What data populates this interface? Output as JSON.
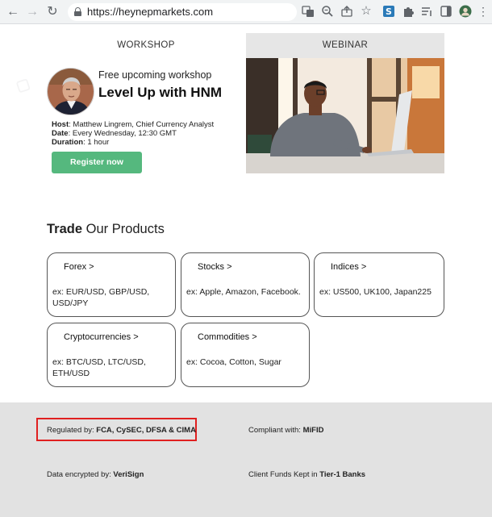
{
  "browser": {
    "url": "https://heynepmarkets.com",
    "back_icon": "back-arrow-icon",
    "forward_icon": "forward-arrow-icon",
    "reload_icon": "reload-icon"
  },
  "tabs": {
    "workshop": "WORKSHOP",
    "webinar": "WEBINAR"
  },
  "workshop": {
    "subtitle": "Free upcoming workshop",
    "title": "Level Up with HNM",
    "host_label": "Host",
    "host_value": ": Matthew Lingrem, Chief Currency Analyst",
    "date_label": "Date",
    "date_value": ": Every Wednesday, 12:30 GMT",
    "duration_label": "Duration",
    "duration_value": ": 1 hour",
    "register_button": "Register now"
  },
  "products": {
    "title_bold": "Trade",
    "title_rest": " Our Products",
    "cards": [
      {
        "name": "Forex >",
        "desc": "ex: EUR/USD, GBP/USD, USD/JPY"
      },
      {
        "name": "Stocks >",
        "desc": "ex: Apple, Amazon, Facebook."
      },
      {
        "name": "Indices >",
        "desc": "ex: US500, UK100, Japan225"
      },
      {
        "name": "Cryptocurrencies >",
        "desc": "ex: BTC/USD, LTC/USD, ETH/USD"
      },
      {
        "name": "Commodities >",
        "desc": "ex: Cocoa, Cotton, Sugar"
      }
    ]
  },
  "footer": {
    "regulated_label": "Regulated by: ",
    "regulated_value": "FCA, CySEC, DFSA & CIMA",
    "compliant_label": "Compliant with: ",
    "compliant_value": "MiFID",
    "encrypted_label": "Data encrypted by: ",
    "encrypted_value": "VeriSign",
    "funds_label": "Client Funds Kept in ",
    "funds_value": "Tier-1 Banks"
  },
  "colors": {
    "register_green": "#55b87e",
    "highlight_red": "#e02020",
    "footer_gray": "#e2e2e2",
    "webinar_tab_gray": "#e6e6e6"
  }
}
